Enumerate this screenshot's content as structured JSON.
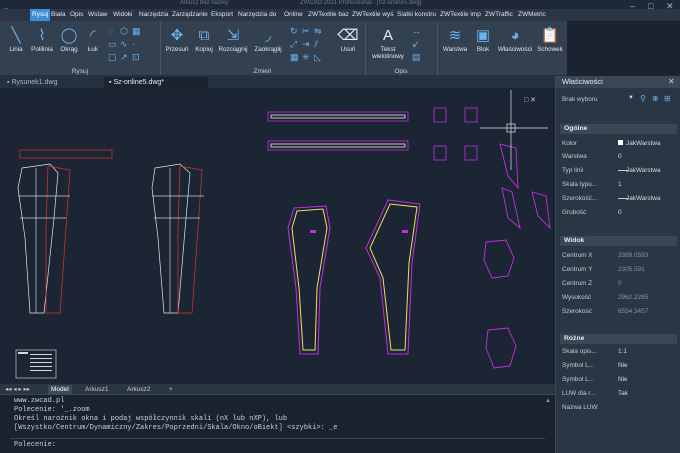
{
  "window": {
    "title": "Arkusz bez nazwy",
    "title2": "ZWCAD 2021 Professional - [Sz-online5.dwg]"
  },
  "menu": [
    "Rysuj",
    "Biała",
    "Opis",
    "Wstaw",
    "Widoki",
    "Narzędzia",
    "Zarządzanie",
    "Eksport",
    "Narzędzia do",
    "Online",
    "ZWTextile baz",
    "ZWTextile wyś",
    "Siatki konstru",
    "ZWTextile imp",
    "ZWTraffic",
    "ZWMetric"
  ],
  "ribbon": {
    "draw": [
      "Linia",
      "Polilinia",
      "Okrąg",
      "Łuk"
    ],
    "modify": [
      "Przesuń",
      "Kopiuj",
      "Rozciągnij",
      "Zaokrąglij",
      "Usuń"
    ],
    "annot": {
      "text": "Tekst",
      "text2": "wielolinowy"
    },
    "extra": [
      "Warstwa",
      "Blok",
      "Właściwości",
      "Schowek"
    ],
    "panels": {
      "draw": "Rysuj",
      "modify": "Zmień",
      "annot": "Opis"
    }
  },
  "files": [
    "Rysunek1.dwg",
    "Sz-online5.dwg*"
  ],
  "viewport_ctl": "□ ✕",
  "layouts": [
    "Model",
    "Arkusz1",
    "Arkusz2",
    "+"
  ],
  "cmd": {
    "lines": [
      "www.zwcad.pl",
      "Polecenie: '_.zoom",
      "Określ narożnik okna i podaj współczynnik skali (nX lub nXP), lub",
      "[Wszystko/Centrum/Dynamiczny/Zakres/Poprzedni/Skala/Okno/oBiekt] <szybki>: _e"
    ],
    "prompt": "Polecenie:"
  },
  "props": {
    "title": "Właściwości",
    "selection": "Brak wyboru",
    "general": {
      "title": "Ogólne",
      "rows": [
        [
          "Kolor",
          "JakWarstwa"
        ],
        [
          "Warstwa",
          "0"
        ],
        [
          "Typ linii",
          "JakWarstwa"
        ],
        [
          "Skala typu...",
          "1"
        ],
        [
          "Szerokość...",
          "JakWarstwa"
        ],
        [
          "Grubość",
          "0"
        ]
      ]
    },
    "view": {
      "title": "Widok",
      "rows": [
        [
          "Centrum X",
          "3389.0593"
        ],
        [
          "Centrum Y",
          "2305.591"
        ],
        [
          "Centrum Z",
          "0"
        ],
        [
          "Wysokość",
          "2962.2285"
        ],
        [
          "Szerokość",
          "6554.3457"
        ]
      ]
    },
    "misc": {
      "title": "Różne",
      "rows": [
        [
          "Skala opis...",
          "1:1"
        ],
        [
          "Symbol L...",
          "Nie"
        ],
        [
          "Symbol L...",
          "Nie"
        ],
        [
          "LUW dla r...",
          "Tak"
        ],
        [
          "Nazwa LUW",
          ""
        ]
      ]
    }
  }
}
